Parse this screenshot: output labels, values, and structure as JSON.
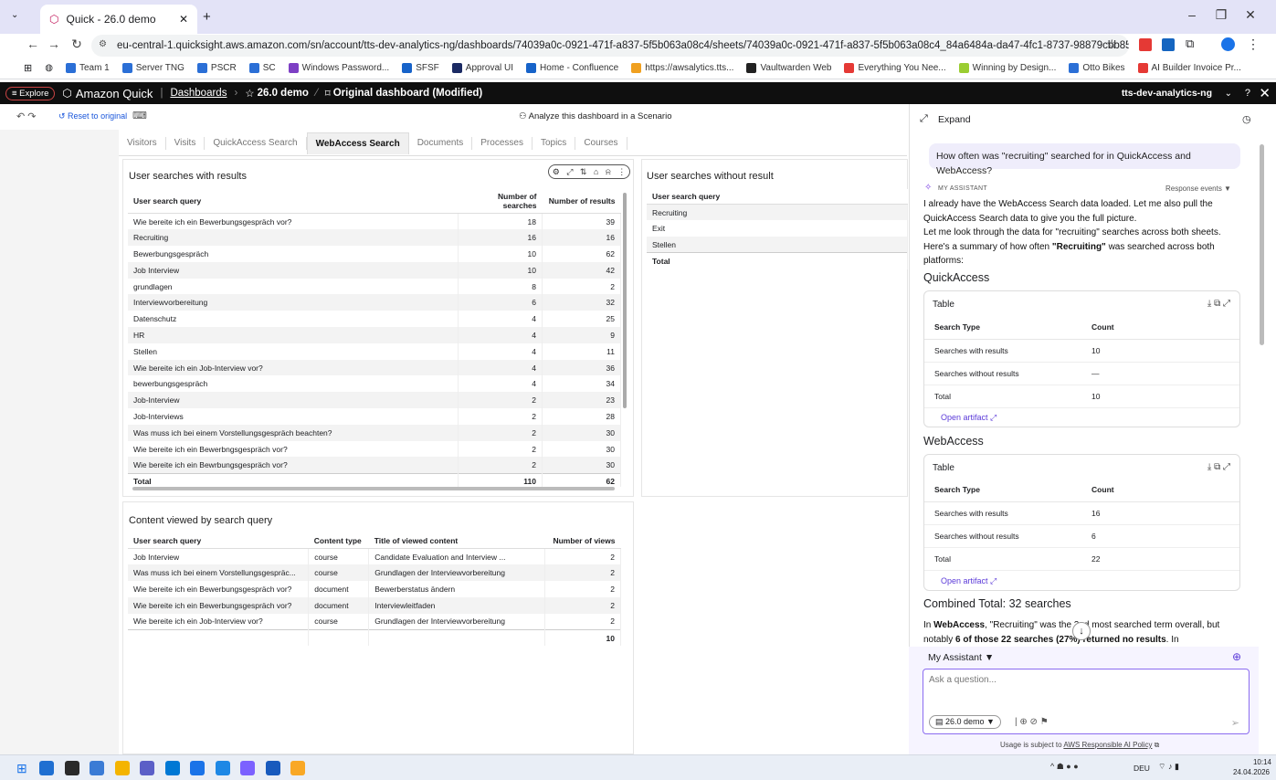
{
  "browser": {
    "tab_title": "Quick - 26.0 demo",
    "url": "eu-central-1.quicksight.aws.amazon.com/sn/account/tts-dev-analytics-ng/dashboards/74039a0c-0921-471f-a837-5f5b063a08c4/sheets/74039a0c-0921-471f-a837-5f5b063a08c4_84a6484a-da47-4fc1-8737-98879cbb85e5",
    "bookmarks": [
      "Team 1",
      "Server TNG",
      "PSCR",
      "SC",
      "Windows Password...",
      "SFSF",
      "Approval UI",
      "Home - Confluence",
      "https://awsalytics.tts...",
      "Vaultwarden Web",
      "Everything You Nee...",
      "Winning by Design...",
      "Otto Bikes",
      "AI Builder Invoice Pr..."
    ],
    "bookmark_colors": [
      "#2b6fd6",
      "#2b6fd6",
      "#2b6fd6",
      "#2b6fd6",
      "#7d3fc4",
      "#1763c9",
      "#1b2a63",
      "#1763c9",
      "#f0a020",
      "#222222",
      "#e53935",
      "#9acd32",
      "#2b6fd6",
      "#e53935"
    ]
  },
  "app": {
    "explore": "≡ Explore",
    "name": "Amazon Quick",
    "breadcrumb_root": "Dashboards",
    "dashboard": "26.0 demo",
    "sheet_state": "Original dashboard (Modified)",
    "account": "tts-dev-analytics-ng",
    "reset": "Reset to original",
    "scenario": "Analyze this dashboard in a Scenario"
  },
  "sheet_tabs": [
    "Visitors",
    "Visits",
    "QuickAccess Search",
    "WebAccess Search",
    "Documents",
    "Processes",
    "Topics",
    "Courses"
  ],
  "active_tab": "WebAccess Search",
  "with_results": {
    "title": "User searches with results",
    "headers": [
      "User search query",
      "Number of searches",
      "Number of results"
    ],
    "rows": [
      [
        "Wie bereite ich ein Bewerbungsgespräch vor?",
        "18",
        "39"
      ],
      [
        "Recruiting",
        "16",
        "16"
      ],
      [
        "Bewerbungsgespräch",
        "10",
        "62"
      ],
      [
        "Job Interview",
        "10",
        "42"
      ],
      [
        "grundlagen",
        "8",
        "2"
      ],
      [
        "Interviewvorbereitung",
        "6",
        "32"
      ],
      [
        "Datenschutz",
        "4",
        "25"
      ],
      [
        "HR",
        "4",
        "9"
      ],
      [
        "Stellen",
        "4",
        "11"
      ],
      [
        "Wie bereite ich ein Job-Interview vor?",
        "4",
        "36"
      ],
      [
        "bewerbungsgespräch",
        "4",
        "34"
      ],
      [
        "Job-Interview",
        "2",
        "23"
      ],
      [
        "Job-Interviews",
        "2",
        "28"
      ],
      [
        "Was muss ich bei einem Vorstellungsgespräch beachten?",
        "2",
        "30"
      ],
      [
        "Wie bereite ich ein Bewerbngsgespräch vor?",
        "2",
        "30"
      ],
      [
        "Wie bereite ich ein Bewrbungsgespräch vor?",
        "2",
        "30"
      ]
    ],
    "total": [
      "Total",
      "110",
      "62"
    ]
  },
  "without_results": {
    "title": "User searches without result",
    "header": "User search query",
    "rows": [
      "Recruiting",
      "Exit",
      "Stellen"
    ],
    "total": "Total"
  },
  "content_viewed": {
    "title": "Content viewed by search query",
    "headers": [
      "User search query",
      "Content type",
      "Title of viewed content",
      "Number of views"
    ],
    "rows": [
      [
        "Job Interview",
        "course",
        "Candidate Evaluation and Interview ...",
        "2"
      ],
      [
        "Was muss ich bei einem Vorstellungsgespräc...",
        "course",
        "Grundlagen der Interviewvorbereitung",
        "2"
      ],
      [
        "Wie bereite ich ein Bewerbungsgespräch vor?",
        "document",
        "Bewerberstatus ändern",
        "2"
      ],
      [
        "Wie bereite ich ein Bewerbungsgespräch vor?",
        "document",
        "Interviewleitfaden",
        "2"
      ],
      [
        "Wie bereite ich ein Job-Interview vor?",
        "course",
        "Grundlagen der Interviewvorbereitung",
        "2"
      ]
    ],
    "total": "10"
  },
  "assistant": {
    "expand": "Expand",
    "question": "How often was \"recruiting\" searched for in QuickAccess and WebAccess?",
    "label": "MY ASSISTANT",
    "response_events": "Response events",
    "p1": "I already have the WebAccess Search data loaded. Let me also pull the QuickAccess Search data to give you the full picture.",
    "p2": "Let me look through the data for \"recruiting\" searches across both sheets.",
    "p3a": "Here's a summary of how often ",
    "p3b": "\"Recruiting\"",
    "p3c": " was searched across both platforms:",
    "qa_heading": "QuickAccess",
    "wa_heading": "WebAccess",
    "table_label": "Table",
    "table_headers": [
      "Search Type",
      "Count"
    ],
    "qa_rows": [
      [
        "Searches with results",
        "10"
      ],
      [
        "Searches without results",
        "—"
      ],
      [
        "Total",
        "10"
      ]
    ],
    "wa_rows": [
      [
        "Searches with results",
        "16"
      ],
      [
        "Searches without results",
        "6"
      ],
      [
        "Total",
        "22"
      ]
    ],
    "open_artifact": "Open artifact",
    "combined": "Combined Total: 32 searches",
    "p4a": "In ",
    "p4b": "WebAccess",
    "p4c": ", \"Recruiting\" was the 2nd most searched term overall, but notably ",
    "p4d": "6 of those 22 searches (27%) returned no results",
    "p4e": ". In",
    "selector": "My Assistant",
    "placeholder": "Ask a question...",
    "scope": "26.0 demo",
    "policy_prefix": "Usage is subject to ",
    "policy_link": "AWS Responsible AI Policy"
  },
  "taskbar": {
    "lang": "DEU",
    "time": "10:14",
    "date": "24.04.2026",
    "app_colors": [
      "#1f6fd1",
      "#2a2a2a",
      "#3a7bd5",
      "#f4b400",
      "#5b5fc7",
      "#0078d4",
      "#1a73e8",
      "#1e88e5",
      "#7b61ff",
      "#185abd",
      "#f9a825"
    ]
  }
}
